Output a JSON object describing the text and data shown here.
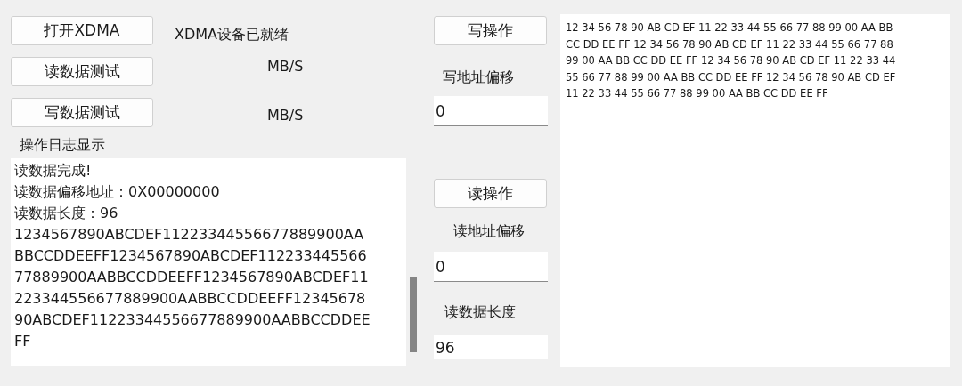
{
  "open_button": "打开XDMA",
  "device_status": "XDMA设备已就绪",
  "read_test": {
    "button": "读数据测试",
    "unit": "MB/S"
  },
  "write_test": {
    "button": "写数据测试",
    "unit": "MB/S"
  },
  "log": {
    "label": "操作日志显示",
    "lines": [
      "读数据完成!",
      "读数据偏移地址：0X00000000",
      "读数据长度：96",
      "1234567890ABCDEF11223344556677889900AA",
      "BBCCDDEEFF1234567890ABCDEF112233445566",
      "77889900AABBCCDDEEFF1234567890ABCDEF11",
      "223344556677889900AABBCCDDEEFF12345678",
      "90ABCDEF11223344556677889900AABBCCDDEE",
      "FF"
    ]
  },
  "write_op": {
    "button": "写操作",
    "offset_label": "写地址偏移",
    "offset_value": "0"
  },
  "read_op": {
    "button": "读操作",
    "offset_label": "读地址偏移",
    "offset_value": "0",
    "length_label": "读数据长度",
    "length_value": "96"
  },
  "data_text": {
    "lines": [
      "12 34 56 78 90 AB CD EF 11 22 33 44 55 66 77 88 99 00 AA BB",
      "CC DD EE FF 12 34 56 78 90 AB CD EF 11 22 33 44 55 66 77 88",
      "99 00 AA BB CC DD EE FF 12 34 56 78 90 AB CD EF 11 22 33 44",
      "55 66 77 88 99 00 AA BB CC DD EE FF 12 34 56 78 90 AB CD EF",
      "11 22 33 44 55 66 77 88 99 00 AA BB CC DD EE FF"
    ]
  }
}
